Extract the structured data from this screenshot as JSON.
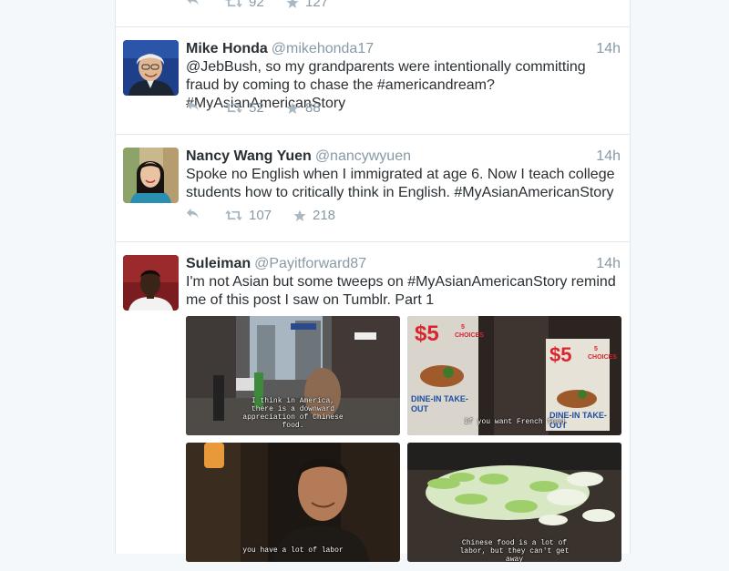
{
  "tweets": [
    {
      "name": "",
      "handle": "",
      "time": "",
      "text": "",
      "retweets": "92",
      "favorites": "127"
    },
    {
      "name": "Mike Honda",
      "handle": "@mikehonda17",
      "time": "14h",
      "text": "@JebBush, so my grandparents were intentionally committing fraud by coming to chase the #americandream? #MyAsianAmericanStory",
      "retweets": "52",
      "favorites": "88"
    },
    {
      "name": "Nancy Wang Yuen",
      "handle": "@nancywyuen",
      "time": "14h",
      "text": "Spoke no English when I immigrated at age 6. Now I teach college students how to critically think in English. #MyAsianAmericanStory",
      "retweets": "107",
      "favorites": "218"
    },
    {
      "name": "Suleiman",
      "handle": "@Payitforward87",
      "time": "14h",
      "text": "I'm not Asian but some tweeps on #MyAsianAmericanStory remind me of this post I saw on Tumblr. Part 1",
      "media": [
        {
          "caption": "I think in America, there is a downward appreciation of Chinese food."
        },
        {
          "caption": "If you want French food",
          "sign_price": "$5",
          "sign_choices": "5 CHOICES",
          "sign_bottom": "DINE-IN TAKE-OUT"
        },
        {
          "caption": "you have a lot of labor"
        },
        {
          "caption": "Chinese food is a lot of labor, but they can't get away"
        }
      ]
    }
  ],
  "icons": {
    "reply": "reply-icon",
    "retweet": "retweet-icon",
    "favorite": "star-icon"
  },
  "colors": {
    "background": "#f5f8fa",
    "meta": "#8899a6",
    "text": "#292f33",
    "border": "#e1e8ed"
  }
}
